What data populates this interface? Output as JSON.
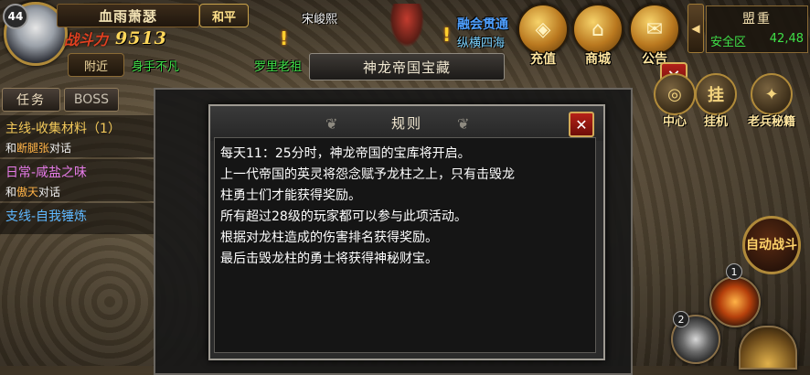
{
  "player": {
    "level": "44",
    "name": "血雨萧瑟",
    "mode": "和平",
    "power_label": "战斗力",
    "power_value": "9513",
    "nearby_label": "附近"
  },
  "world": {
    "npc_name": "宋峻熙",
    "guild_name": "融会贯通",
    "title_text": "纵横四海",
    "player_title": "身手不凡",
    "other_name": "罗里老祖"
  },
  "top_icons": [
    {
      "label": "充值",
      "icon": "gold-ingot-icon",
      "glyph": "◈"
    },
    {
      "label": "商城",
      "icon": "shop-building-icon",
      "glyph": "⌂"
    },
    {
      "label": "公告",
      "icon": "scroll-icon",
      "glyph": "✉"
    }
  ],
  "map": {
    "name": "盟重",
    "zone": "安全区",
    "coords": "42,48"
  },
  "event": {
    "title": "神龙帝国宝藏"
  },
  "side_buttons": [
    {
      "label": "中心",
      "icon": "center-icon",
      "glyph": "◎"
    },
    {
      "label": "挂机",
      "icon": "idle-icon",
      "glyph": "挂"
    },
    {
      "label": "老兵秘籍",
      "icon": "book-icon",
      "glyph": "✦"
    }
  ],
  "auto_battle_label": "自动战斗",
  "skills": {
    "count_top": "1",
    "count_bottom": "2"
  },
  "tasks": {
    "tabs": [
      "任务",
      "BOSS"
    ],
    "items": [
      {
        "title": "主线-收集材料（1）",
        "desc_prefix": "和",
        "desc_name": "断腿张",
        "desc_suffix": "对话",
        "title_color": "#f3c95a"
      },
      {
        "title": "日常-咸盐之味",
        "desc_prefix": "和",
        "desc_name": "傲天",
        "desc_suffix": "对话",
        "title_color": "#e67be8"
      },
      {
        "title": "支线-自我锤炼",
        "desc_prefix": "",
        "desc_name": "",
        "desc_suffix": "",
        "title_color": "#5fb8ff"
      }
    ]
  },
  "rules": {
    "title": "规则",
    "lines": [
      "每天11：25分时，神龙帝国的宝库将开启。",
      "上一代帝国的英灵将怨念赋予龙柱之上，只有击毁龙",
      "柱勇士们才能获得奖励。",
      "所有超过28级的玩家都可以参与此项活动。",
      "根据对龙柱造成的伤害排名获得奖励。",
      "最后击毁龙柱的勇士将获得神秘财宝。"
    ]
  },
  "colors": {
    "accent_gold": "#ffd75a",
    "safe_zone_green": "#3fe048",
    "close_red": "#b62218"
  }
}
